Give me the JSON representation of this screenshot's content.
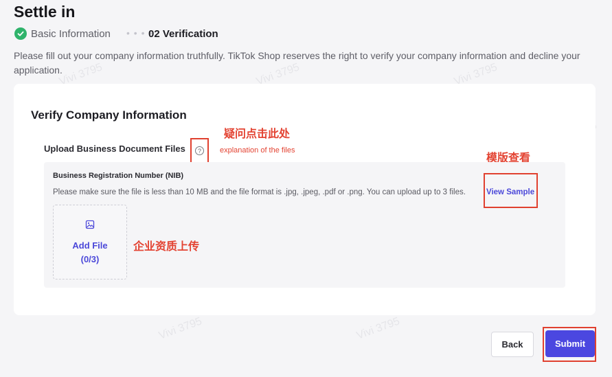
{
  "header": {
    "title": "Settle in"
  },
  "steps": [
    {
      "label": "Basic Information",
      "status": "done"
    },
    {
      "label": "02 Verification",
      "status": "current"
    }
  ],
  "intro": "Please fill out your company information truthfully. TikTok Shop reserves the right to verify your company information and decline your application.",
  "card": {
    "title": "Verify Company Information",
    "upload_label": "Upload Business Document Files",
    "help_icon_glyph": "?",
    "doc": {
      "title": "Business Registration Number (NIB)",
      "hint": "Please make sure the file is less than 10 MB and the file format is .jpg, .jpeg, .pdf or .png. You can upload up to 3 files.",
      "view_sample": "View Sample",
      "add_file": "Add File",
      "count": "(0/3)"
    }
  },
  "annotations": {
    "help_cn": "疑问点击此处",
    "help_en": "explanation of the files",
    "sample_cn": "模版查看",
    "upload_cn": "企业资质上传",
    "color": "#e34332"
  },
  "footer": {
    "back": "Back",
    "submit": "Submit"
  },
  "watermark": "Vivi 3795",
  "colors": {
    "accent": "#4b47e0",
    "success": "#2fb36b",
    "annotation": "#e0402f"
  }
}
